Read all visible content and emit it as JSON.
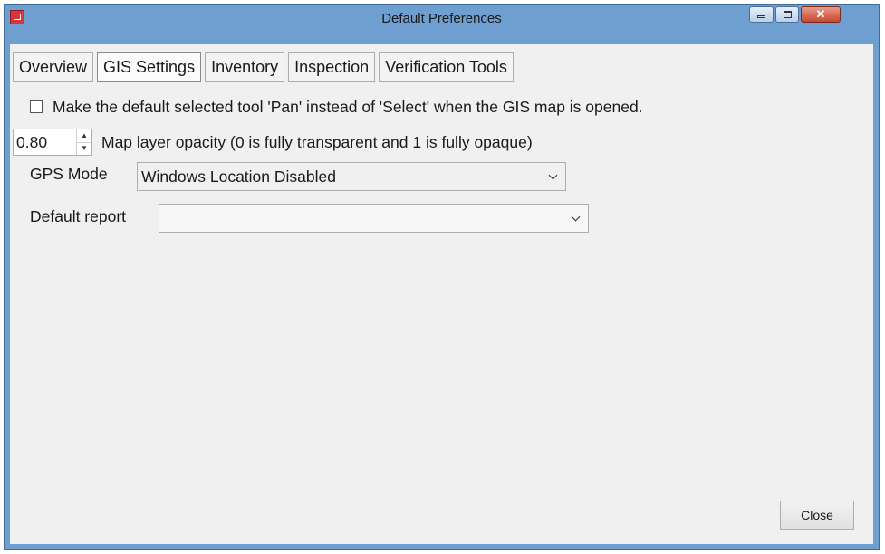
{
  "window": {
    "title": "Default Preferences"
  },
  "tabs": [
    {
      "label": "Overview",
      "active": false
    },
    {
      "label": "GIS Settings",
      "active": true
    },
    {
      "label": "Inventory",
      "active": false
    },
    {
      "label": "Inspection",
      "active": false
    },
    {
      "label": "Verification Tools",
      "active": false
    }
  ],
  "gis": {
    "pan_option_label": "Make the default selected tool 'Pan' instead of 'Select' when the GIS map is opened.",
    "pan_option_checked": false,
    "opacity_value": "0.80",
    "opacity_label": "Map layer opacity (0 is fully transparent and 1 is fully opaque)",
    "gps_label": "GPS Mode",
    "gps_value": "Windows Location Disabled",
    "report_label": "Default report",
    "report_value": ""
  },
  "buttons": {
    "close_label": "Close"
  }
}
